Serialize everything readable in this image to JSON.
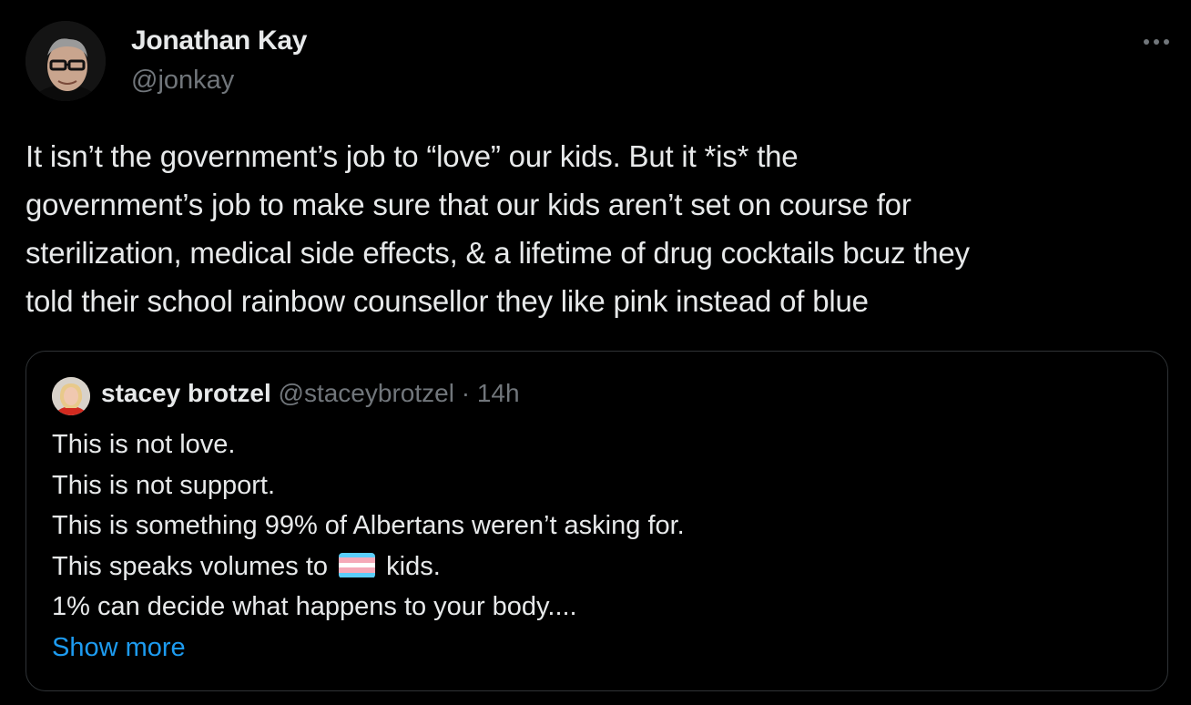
{
  "author": {
    "name": "Jonathan Kay",
    "handle": "@jonkay"
  },
  "tweet": {
    "text": "It isn’t the government’s job to “love” our kids. But it *is* the\ngovernment’s job to make sure that our kids aren’t set on course for\nsterilization, medical side effects, & a lifetime of drug cocktails bcuz they\ntold their school rainbow counsellor they like pink instead of blue"
  },
  "quoted_tweet": {
    "name": "stacey brotzel",
    "handle": "@staceybrotzel",
    "separator": "·",
    "time": "14h",
    "lines": [
      "This is not love.",
      "This is not support.",
      "This is something 99% of Albertans weren’t asking for."
    ],
    "flag_line": {
      "before": "This speaks volumes to",
      "emoji": "transgender-flag-emoji",
      "after": "kids."
    },
    "last_line": "1% can decide what happens to your body....",
    "show_more_label": "Show more"
  },
  "icons": {
    "more": "more-horizontal-icon"
  },
  "colors": {
    "background": "#000000",
    "primary_text": "#e7e9ea",
    "secondary_text": "#71767b",
    "link": "#1d9bf0",
    "border": "#2f3336",
    "flag_blue": "#5bcefa",
    "flag_pink": "#f5a9b8",
    "flag_white": "#ffffff"
  }
}
